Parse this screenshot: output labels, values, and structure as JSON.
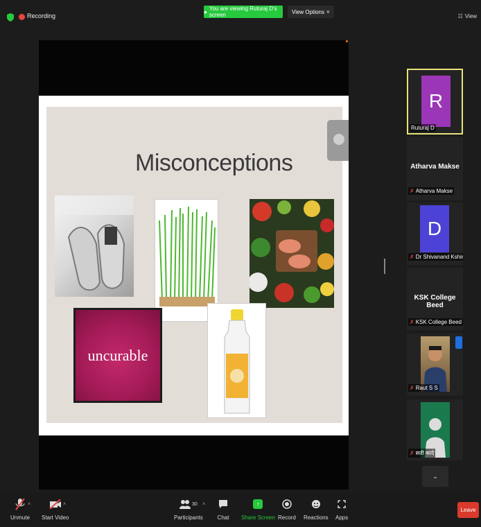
{
  "topbar": {
    "recording_label": "Recording",
    "viewing_label": "You are viewing Ruturaj D's screen",
    "view_options_label": "View Options",
    "view_label": "View"
  },
  "slide": {
    "title": "Misconceptions",
    "box_text": "uncurable"
  },
  "participants": [
    {
      "name": "Ruturaj D",
      "initial": "R",
      "avatar_color": "#9b36b7",
      "active": true
    },
    {
      "name": "Atharva Makse",
      "display": "Atharva Makse",
      "muted": true
    },
    {
      "name": "Dr Shivanand Kshirsa...",
      "initial": "D",
      "avatar_color": "#4c43d6",
      "muted": true
    },
    {
      "name": "KSK College Beed",
      "display": "KSK College Beed",
      "muted": true
    },
    {
      "name": "Raut S S",
      "muted": true
    },
    {
      "name": "सती कांदे",
      "muted": true
    }
  ],
  "toolbar": {
    "unmute": "Unmute",
    "start_video": "Start Video",
    "participants": "Participants",
    "participants_count": "30",
    "chat": "Chat",
    "share_screen": "Share Screen",
    "record": "Record",
    "reactions": "Reactions",
    "apps": "Apps",
    "leave": "Leave"
  },
  "colors": {
    "share_green": "#27c93f",
    "leave_red": "#d93a2b",
    "active_border": "#e6e37a"
  }
}
